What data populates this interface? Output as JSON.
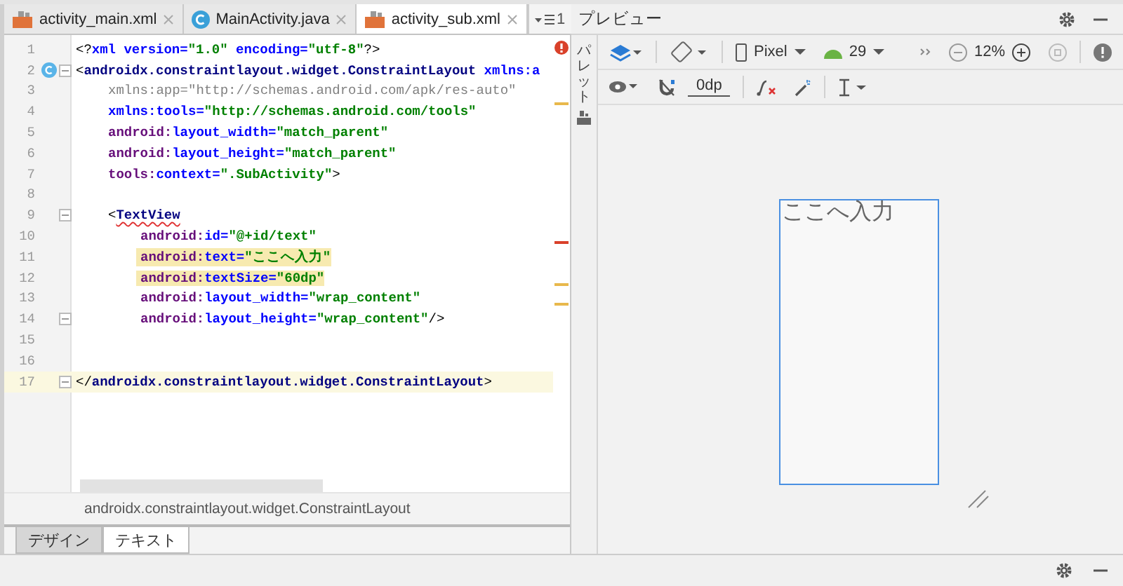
{
  "editor_tabs": [
    {
      "label": "activity_main.xml",
      "kind": "xml",
      "selected": false
    },
    {
      "label": "MainActivity.java",
      "kind": "class",
      "selected": false
    },
    {
      "label": "activity_sub.xml",
      "kind": "xml",
      "selected": true
    }
  ],
  "tab_overflow": "1",
  "code_lines": [
    {
      "number": "1",
      "fold": false,
      "gutter_icon": false,
      "highlighted": false,
      "current": false,
      "tokens": [
        {
          "kind": "punct",
          "text": "<?"
        },
        {
          "kind": "attr",
          "text": "xml version="
        },
        {
          "kind": "value",
          "text": "\"1.0\""
        },
        {
          "kind": "attr",
          "text": " encoding="
        },
        {
          "kind": "value",
          "text": "\"utf-8\""
        },
        {
          "kind": "punct",
          "text": "?>"
        }
      ]
    },
    {
      "number": "2",
      "fold": true,
      "gutter_icon": true,
      "highlighted": false,
      "current": false,
      "tokens": [
        {
          "kind": "punct",
          "text": "<"
        },
        {
          "kind": "tag",
          "text": "androidx.constraintlayout.widget.ConstraintLayout"
        },
        {
          "kind": "attr",
          "text": " xmlns:a"
        }
      ],
      "children": [
        {
          "number": "3",
          "fold": false,
          "gutter_icon": false,
          "highlighted": false,
          "current": false,
          "tokens": [
            {
              "kind": "unused",
              "text": "xmlns:app=\"http://schemas.android.com/apk/res-auto\""
            }
          ]
        },
        {
          "number": "4",
          "fold": false,
          "gutter_icon": false,
          "highlighted": false,
          "current": false,
          "tokens": [
            {
              "kind": "attr",
              "text": "xmlns:tools="
            },
            {
              "kind": "value",
              "text": "\"http://schemas.android.com/tools\""
            }
          ]
        },
        {
          "number": "5",
          "fold": false,
          "gutter_icon": false,
          "highlighted": false,
          "current": false,
          "tokens": [
            {
              "kind": "prefix",
              "text": "android:"
            },
            {
              "kind": "attr",
              "text": "layout_width="
            },
            {
              "kind": "value",
              "text": "\"match_parent\""
            }
          ]
        },
        {
          "number": "6",
          "fold": false,
          "gutter_icon": false,
          "highlighted": false,
          "current": false,
          "tokens": [
            {
              "kind": "prefix",
              "text": "android:"
            },
            {
              "kind": "attr",
              "text": "layout_height="
            },
            {
              "kind": "value",
              "text": "\"match_parent\""
            }
          ]
        },
        {
          "number": "7",
          "fold": false,
          "gutter_icon": false,
          "highlighted": false,
          "current": false,
          "tokens": [
            {
              "kind": "prefix",
              "text": "tools:"
            },
            {
              "kind": "attr",
              "text": "context="
            },
            {
              "kind": "value",
              "text": "\".SubActivity\""
            },
            {
              "kind": "punct",
              "text": ">"
            }
          ]
        },
        {
          "number": "8"
        },
        {
          "number": "9",
          "fold": true,
          "gutter_icon": false,
          "highlighted": false,
          "current": false,
          "tokens": [
            {
              "kind": "punct",
              "text": "<"
            },
            {
              "kind": "tag_error",
              "text": "TextView"
            }
          ],
          "children": [
            {
              "number": "10",
              "fold": false,
              "gutter_icon": false,
              "highlighted": false,
              "current": false,
              "tokens": [
                {
                  "kind": "prefix",
                  "text": "android:"
                },
                {
                  "kind": "attr",
                  "text": "id="
                },
                {
                  "kind": "value",
                  "text": "\"@+id/text\""
                }
              ]
            },
            {
              "number": "11",
              "fold": false,
              "gutter_icon": false,
              "highlighted": true,
              "current": false,
              "tokens": [
                {
                  "kind": "prefix",
                  "text": "android:"
                },
                {
                  "kind": "attr",
                  "text": "text="
                },
                {
                  "kind": "value",
                  "text": "\"ここへ入力\""
                }
              ]
            },
            {
              "number": "12",
              "fold": false,
              "gutter_icon": false,
              "highlighted": true,
              "current": false,
              "tokens": [
                {
                  "kind": "prefix",
                  "text": "android:"
                },
                {
                  "kind": "attr",
                  "text": "textSize="
                },
                {
                  "kind": "value",
                  "text": "\"60dp\""
                }
              ]
            },
            {
              "number": "13",
              "fold": false,
              "gutter_icon": false,
              "highlighted": false,
              "current": false,
              "tokens": [
                {
                  "kind": "prefix",
                  "text": "android:"
                },
                {
                  "kind": "attr",
                  "text": "layout_width="
                },
                {
                  "kind": "value",
                  "text": "\"wrap_content\""
                }
              ]
            },
            {
              "number": "14",
              "fold": true,
              "gutter_icon": false,
              "highlighted": false,
              "current": false,
              "tokens": [
                {
                  "kind": "prefix",
                  "text": "android:"
                },
                {
                  "kind": "attr",
                  "text": "layout_height="
                },
                {
                  "kind": "value",
                  "text": "\"wrap_content\""
                },
                {
                  "kind": "punct",
                  "text": "/>"
                }
              ]
            }
          ]
        },
        {
          "number": "15"
        },
        {
          "number": "16"
        }
      ]
    },
    {
      "number": "17",
      "fold": true,
      "gutter_icon": false,
      "highlighted": false,
      "current": true,
      "tokens": [
        {
          "kind": "punct",
          "text": "</"
        },
        {
          "kind": "tag",
          "text": "androidx.constraintlayout.widget.ConstraintLayout"
        },
        {
          "kind": "punct",
          "text": ">"
        }
      ]
    }
  ],
  "breadcrumb": "androidx.constraintlayout.widget.ConstraintLayout",
  "mode_tabs": [
    {
      "label": "デザイン",
      "selected": false
    },
    {
      "label": "テキスト",
      "selected": true
    }
  ],
  "preview": {
    "title": "プレビュー",
    "palette_label": "パレット",
    "device": "Pixel",
    "api_level": "29",
    "zoom": "12%",
    "margin": "0dp",
    "sample_text": "ここへ入力"
  }
}
